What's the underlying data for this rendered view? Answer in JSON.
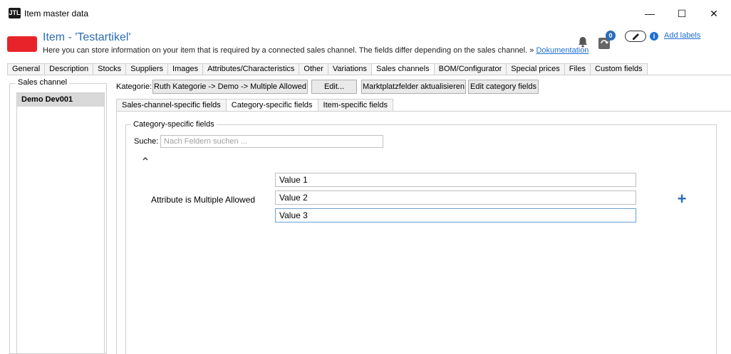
{
  "window": {
    "logo_text": "JTL",
    "title": "Item master data",
    "minimize": "—",
    "maximize": "☐",
    "close": "✕"
  },
  "header": {
    "item_title": "Item - 'Testartikel'",
    "item_color": "#e8242a",
    "description": "Here you can store information on your item that is required by a connected sales channel. The fields differ depending on the sales channel.",
    "arrow": "»",
    "doc_link": "Dokumentation",
    "notification_count": "0",
    "info_glyph": "i",
    "add_labels": "Add labels"
  },
  "tabs": [
    {
      "label": "General",
      "active": false
    },
    {
      "label": "Description",
      "active": false
    },
    {
      "label": "Stocks",
      "active": false
    },
    {
      "label": "Suppliers",
      "active": false
    },
    {
      "label": "Images",
      "active": false
    },
    {
      "label": "Attributes/Characteristics",
      "active": false
    },
    {
      "label": "Other",
      "active": false
    },
    {
      "label": "Variations",
      "active": false
    },
    {
      "label": "Sales channels",
      "active": true
    },
    {
      "label": "BOM/Configurator",
      "active": false
    },
    {
      "label": "Special prices",
      "active": false
    },
    {
      "label": "Files",
      "active": false
    },
    {
      "label": "Custom fields",
      "active": false
    }
  ],
  "sales_channel": {
    "legend": "Sales channel",
    "items": [
      "Demo Dev001"
    ]
  },
  "kategorie": {
    "label": "Kategorie:",
    "value": "Ruth Kategorie -> Demo -> Multiple Allowed",
    "edit_button": "Edit...",
    "update_button": "Marktplatzfelder aktualisieren",
    "edit_category_button": "Edit category fields"
  },
  "subtabs": [
    {
      "label": "Sales-channel-specific fields",
      "active": false
    },
    {
      "label": "Category-specific fields",
      "active": true
    },
    {
      "label": "Item-specific fields",
      "active": false
    }
  ],
  "category_fields": {
    "legend": "Category-specific fields",
    "search_label": "Suche:",
    "search_placeholder": "Nach Feldern suchen ...",
    "attribute_label": "Attribute is Multiple Allowed",
    "values": [
      "Value 1",
      "Value 2",
      "Value 3"
    ],
    "add_glyph": "+"
  },
  "colors": {
    "accent": "#2a6bb8",
    "link": "#1f6fd1"
  }
}
